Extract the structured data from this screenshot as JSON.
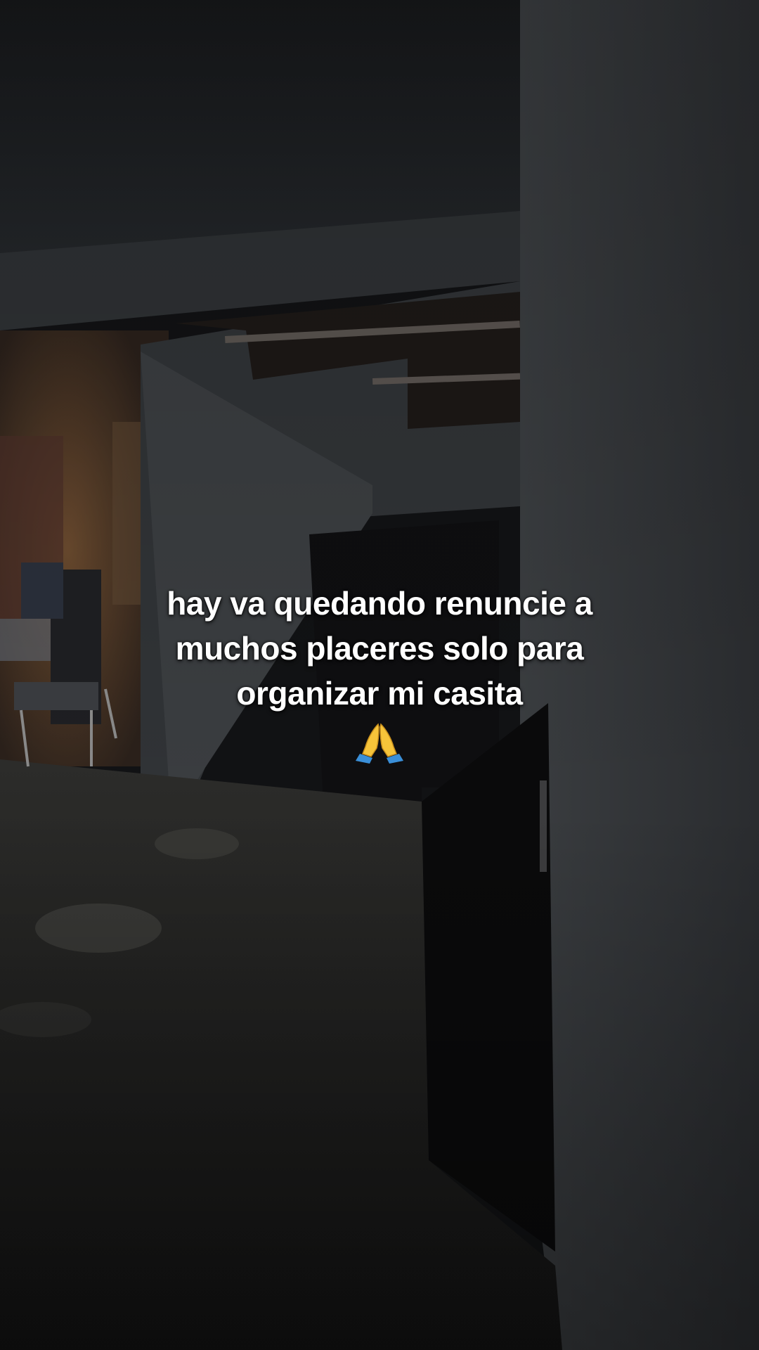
{
  "caption": {
    "lines": [
      "hay va quedando renuncie a",
      "muchos placeres solo para",
      "organizar mi casita"
    ],
    "emoji": "folded-hands"
  },
  "colors": {
    "caption_text": "#ffffff",
    "emoji_hands": "#f6c43a",
    "emoji_sleeves": "#3a8fd8"
  }
}
